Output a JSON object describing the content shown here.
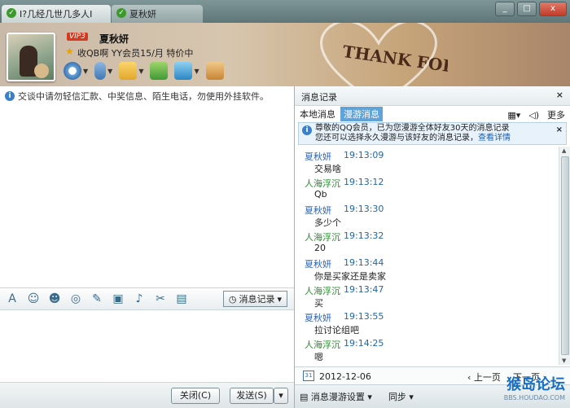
{
  "tabs": [
    {
      "label": "I?几经几世几多人I",
      "icon": "tick-icon"
    },
    {
      "label": "夏秋妍",
      "icon": "tick-icon"
    }
  ],
  "window_buttons": {
    "minimize": "_",
    "maximize": "□",
    "close": "x"
  },
  "header": {
    "vip": "VIP3",
    "name": "夏秋妍",
    "signature": "收QB啊 YY会员15/月 特价中",
    "decor_text": "THANK FOR!"
  },
  "left": {
    "notice": "交谈中请勿轻信汇款、中奖信息、陌生电话，勿使用外挂软件。",
    "history_button": "消息记录",
    "close_button": "关闭(C)",
    "send_button": "发送(S)"
  },
  "right": {
    "title": "消息记录",
    "tab_local": "本地消息",
    "tab_roam": "漫游消息",
    "more": "更多",
    "banner_line1": "尊敬的QQ会员，已为您漫游全体好友30天的消息记录",
    "banner_line2": "您还可以选择永久漫游与该好友的消息记录，",
    "banner_link": "查看详情",
    "date": "2012-12-06",
    "prev": "上一页",
    "next": "下一页",
    "roam_settings": "消息漫游设置",
    "sync": "同步",
    "watermark": "猴岛论坛",
    "watermark_url": "BBS.HOUDAO.COM"
  },
  "messages": [
    {
      "who": "夏秋妍",
      "side": "self",
      "time": "19:13:09",
      "text": "交易啥"
    },
    {
      "who": "人海浮沉",
      "side": "other",
      "time": "19:13:12",
      "text": "Qb"
    },
    {
      "who": "夏秋妍",
      "side": "self",
      "time": "19:13:30",
      "text": "多少个"
    },
    {
      "who": "人海浮沉",
      "side": "other",
      "time": "19:13:32",
      "text": "20"
    },
    {
      "who": "夏秋妍",
      "side": "self",
      "time": "19:13:44",
      "text": "你是买家还是卖家"
    },
    {
      "who": "人海浮沉",
      "side": "other",
      "time": "19:13:47",
      "text": "买"
    },
    {
      "who": "夏秋妍",
      "side": "self",
      "time": "19:13:55",
      "text": "拉讨论组吧"
    },
    {
      "who": "人海浮沉",
      "side": "other",
      "time": "19:14:25",
      "text": "嗯"
    }
  ]
}
